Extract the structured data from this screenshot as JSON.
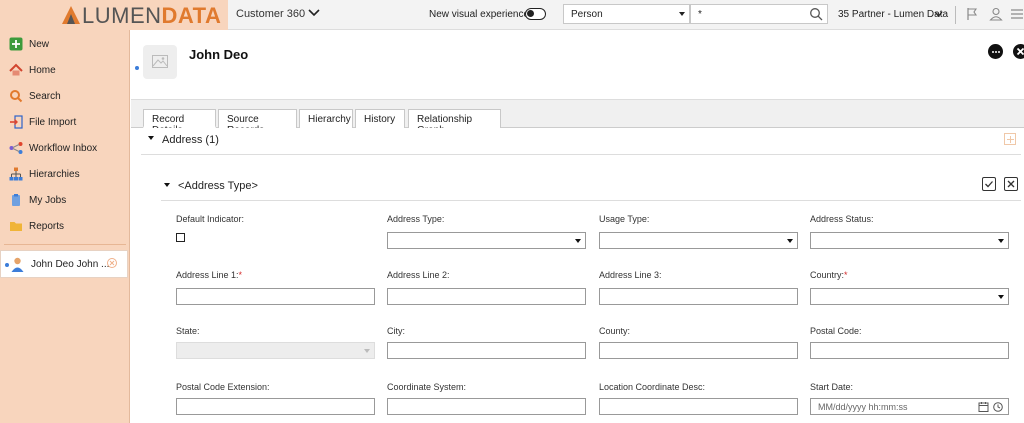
{
  "brand": {
    "name_part1": "LUMEN",
    "name_part2": "DATA",
    "accent": "#e07a2e"
  },
  "app": {
    "title": "Customer 360"
  },
  "topbar": {
    "new_visual_label": "New visual experience",
    "entity_select": "Person",
    "search_value": "*",
    "org_label": "35 Partner - Lumen Data",
    "icons": [
      "flag-icon",
      "user-icon",
      "menu-icon"
    ]
  },
  "sidebar": {
    "items": [
      {
        "label": "New",
        "icon": "plus-icon"
      },
      {
        "label": "Home",
        "icon": "home-icon"
      },
      {
        "label": "Search",
        "icon": "search-icon"
      },
      {
        "label": "File Import",
        "icon": "file-import-icon"
      },
      {
        "label": "Workflow Inbox",
        "icon": "workflow-icon"
      },
      {
        "label": "Hierarchies",
        "icon": "hierarchy-icon"
      },
      {
        "label": "My Jobs",
        "icon": "jobs-icon"
      },
      {
        "label": "Reports",
        "icon": "folder-icon"
      }
    ],
    "recent": {
      "label": "John Deo John ..."
    }
  },
  "record": {
    "title": "John Deo"
  },
  "tabs": [
    "Record Details",
    "Source Records",
    "Hierarchy",
    "History",
    "Relationship Graph"
  ],
  "section": {
    "title": "Address (1)",
    "subtitle": "<Address Type>"
  },
  "fields": {
    "default_indicator": "Default Indicator:",
    "address_type": "Address Type:",
    "usage_type": "Usage Type:",
    "address_status": "Address Status:",
    "address_line1": "Address Line 1:",
    "address_line2": "Address Line 2:",
    "address_line3": "Address Line 3:",
    "country": "Country:",
    "state": "State:",
    "city": "City:",
    "county": "County:",
    "postal_code": "Postal Code:",
    "postal_code_ext": "Postal Code Extension:",
    "coordinate_system": "Coordinate System:",
    "location_coord_desc": "Location Coordinate Desc:",
    "start_date": "Start Date:",
    "start_date_placeholder": "MM/dd/yyyy hh:mm:ss"
  },
  "colors": {
    "sidebar_bg": "#f8d5bd",
    "link_blue": "#3c7dd9",
    "required": "#d42a2a"
  }
}
